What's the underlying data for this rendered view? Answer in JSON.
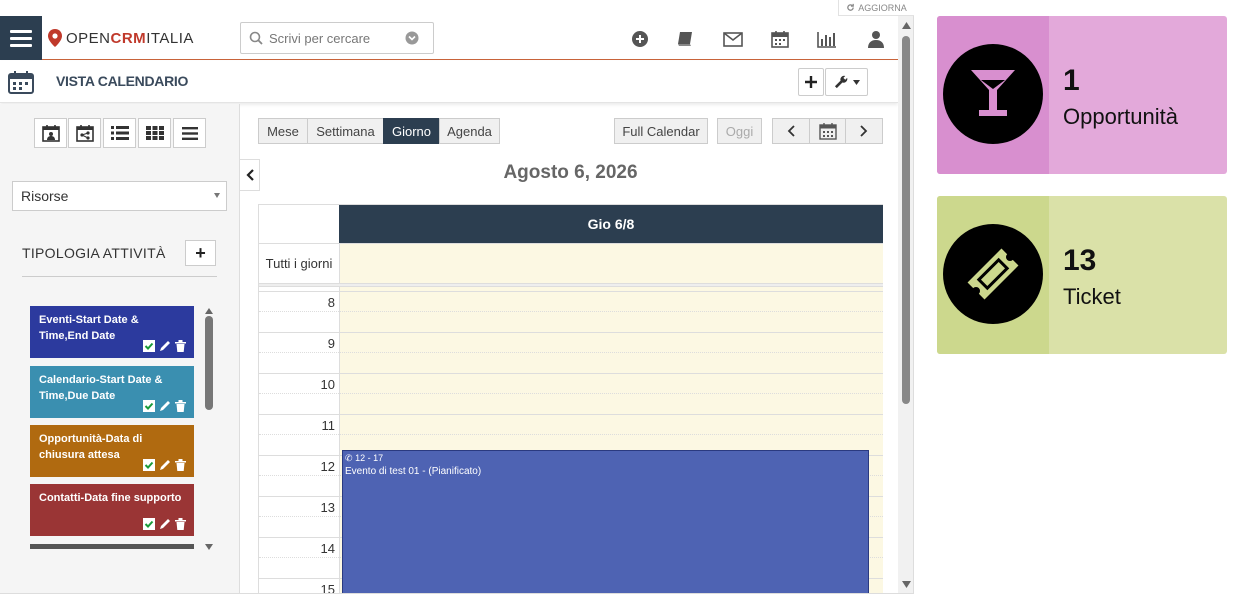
{
  "topbar": {
    "refresh_label": "AGGIORNA"
  },
  "header": {
    "logo_open": "OPEN",
    "logo_crm": "CRM",
    "logo_italia": "ITALIA",
    "search_placeholder": "Scrivi per cercare",
    "icons": [
      "plus-circle-icon",
      "book-icon",
      "envelope-icon",
      "calendar-icon",
      "bar-chart-icon",
      "user-icon"
    ]
  },
  "subheader": {
    "title": "VISTA CALENDARIO"
  },
  "sidebar": {
    "view_buttons": [
      "calendar-user-icon",
      "calendar-share-icon",
      "list-icon",
      "grid-icon",
      "menu-lines-icon"
    ],
    "resource_select": "Risorse",
    "activity_types_title": "TIPOLOGIA ATTIVITÀ",
    "activity_types": [
      {
        "label": "Eventi-Start Date & Time,End Date",
        "color": "#2c3a9e"
      },
      {
        "label": "Calendario-Start Date & Time,Due Date",
        "color": "#3a8fb0"
      },
      {
        "label": "Opportunità-Data di chiusura attesa",
        "color": "#b06a10"
      },
      {
        "label": "Contatti-Data fine supporto",
        "color": "#9a3535"
      }
    ]
  },
  "calendar": {
    "views": [
      "Mese",
      "Settimana",
      "Giorno",
      "Agenda"
    ],
    "active_view": "Giorno",
    "full_calendar": "Full Calendar",
    "today": "Oggi",
    "title": "Agosto 6, 2026",
    "column_header": "Gio 6/8",
    "all_day_label": "Tutti i giorni",
    "hours": [
      "8",
      "9",
      "10",
      "11",
      "12",
      "13",
      "14",
      "15"
    ],
    "event": {
      "time": "12 - 17",
      "title": "Evento di test 01 - (Pianificato)"
    }
  },
  "widgets": [
    {
      "count": "1",
      "label": "Opportunità",
      "color_dark": "#d88fcf",
      "color_light": "#e3a9da",
      "icon": "cocktail-glass-icon"
    },
    {
      "count": "13",
      "label": "Ticket",
      "color_dark": "#ccd88d",
      "color_light": "#dae1a8",
      "icon": "ticket-icon"
    }
  ]
}
